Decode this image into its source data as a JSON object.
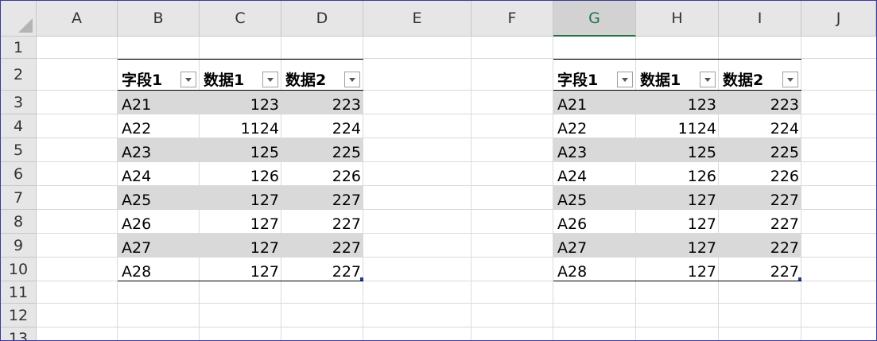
{
  "sheet": {
    "columns": [
      "A",
      "B",
      "C",
      "D",
      "E",
      "F",
      "G",
      "H",
      "I",
      "J"
    ],
    "rows": [
      "1",
      "2",
      "3",
      "4",
      "5",
      "6",
      "7",
      "8",
      "9",
      "10",
      "11",
      "12",
      "13"
    ],
    "selected_column": "G"
  },
  "tables": [
    {
      "headers": [
        "字段1",
        "数据1",
        "数据2"
      ],
      "rows": [
        [
          "A21",
          "123",
          "223"
        ],
        [
          "A22",
          "1124",
          "224"
        ],
        [
          "A23",
          "125",
          "225"
        ],
        [
          "A24",
          "126",
          "226"
        ],
        [
          "A25",
          "127",
          "227"
        ],
        [
          "A26",
          "127",
          "227"
        ],
        [
          "A27",
          "127",
          "227"
        ],
        [
          "A28",
          "127",
          "227"
        ]
      ]
    },
    {
      "headers": [
        "字段1",
        "数据1",
        "数据2"
      ],
      "rows": [
        [
          "A21",
          "123",
          "223"
        ],
        [
          "A22",
          "1124",
          "224"
        ],
        [
          "A23",
          "125",
          "225"
        ],
        [
          "A24",
          "126",
          "226"
        ],
        [
          "A25",
          "127",
          "227"
        ],
        [
          "A26",
          "127",
          "227"
        ],
        [
          "A27",
          "127",
          "227"
        ],
        [
          "A28",
          "127",
          "227"
        ]
      ]
    }
  ],
  "colors": {
    "band": "#d9d9d9",
    "header_bg": "#e6e6e6",
    "selection_accent": "#217346",
    "frame": "#3a3a9a"
  }
}
